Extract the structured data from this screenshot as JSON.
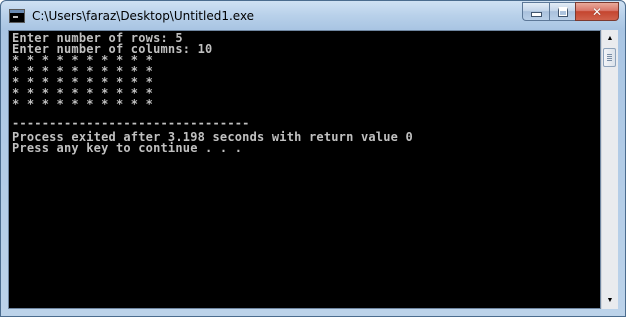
{
  "window": {
    "title": "C:\\Users\\faraz\\Desktop\\Untitled1.exe",
    "icons": {
      "app": "console-app-icon",
      "minimize": "minimize-icon",
      "maximize": "maximize-icon",
      "close": "close-icon"
    },
    "close_glyph": "✕"
  },
  "console": {
    "lines": [
      "Enter number of rows: 5",
      "Enter number of columns: 10",
      "* * * * * * * * * *",
      "* * * * * * * * * *",
      "* * * * * * * * * *",
      "* * * * * * * * * *",
      "* * * * * * * * * *",
      "",
      "--------------------------------",
      "Process exited after 3.198 seconds with return value 0",
      "Press any key to continue . . ."
    ],
    "background": "#000000",
    "text_color": "#c0c0c0"
  },
  "scrollbar": {
    "up_arrow": "▲",
    "down_arrow": "▼"
  }
}
